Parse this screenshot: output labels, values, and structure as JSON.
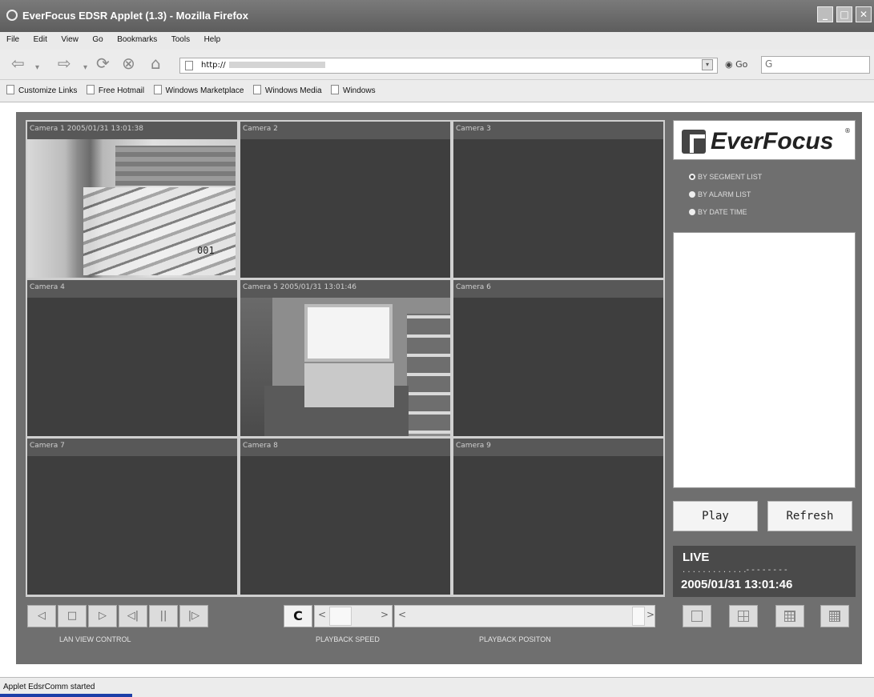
{
  "window": {
    "title": "EverFocus EDSR Applet (1.3) - Mozilla Firefox"
  },
  "menu": [
    "File",
    "Edit",
    "View",
    "Go",
    "Bookmarks",
    "Tools",
    "Help"
  ],
  "nav": {
    "url": "http://",
    "go_label": "Go"
  },
  "bookmarks": [
    "Customize Links",
    "Free Hotmail",
    "Windows Marketplace",
    "Windows Media",
    "Windows"
  ],
  "cameras": [
    "Camera 1 2005/01/31 13:01:38",
    "Camera 2",
    "Camera 3",
    "Camera 4",
    "Camera 5 2005/01/31 13:01:46",
    "Camera 6",
    "Camera 7",
    "Camera 8",
    "Camera 9"
  ],
  "camera1_overlay": "001",
  "brand": {
    "name": "EverFocus",
    "reg": "®"
  },
  "search_modes": [
    {
      "label": "BY SEGMENT LIST",
      "selected": true
    },
    {
      "label": "BY ALARM LIST",
      "selected": false
    },
    {
      "label": "BY DATE TIME",
      "selected": false
    }
  ],
  "buttons": {
    "play": "Play",
    "refresh": "Refresh"
  },
  "live": {
    "label": "LIVE",
    "dots": ". . . . . . . . . . . . .- - - - - - - -",
    "datetime": "2005/01/31  13:01:46"
  },
  "controls": {
    "speed_label": "C",
    "lan_view_control": "LAN VIEW CONTROL",
    "playback_speed": "PLAYBACK SPEED",
    "playback_position": "PLAYBACK POSITON"
  },
  "status": "Applet EdsrComm started"
}
